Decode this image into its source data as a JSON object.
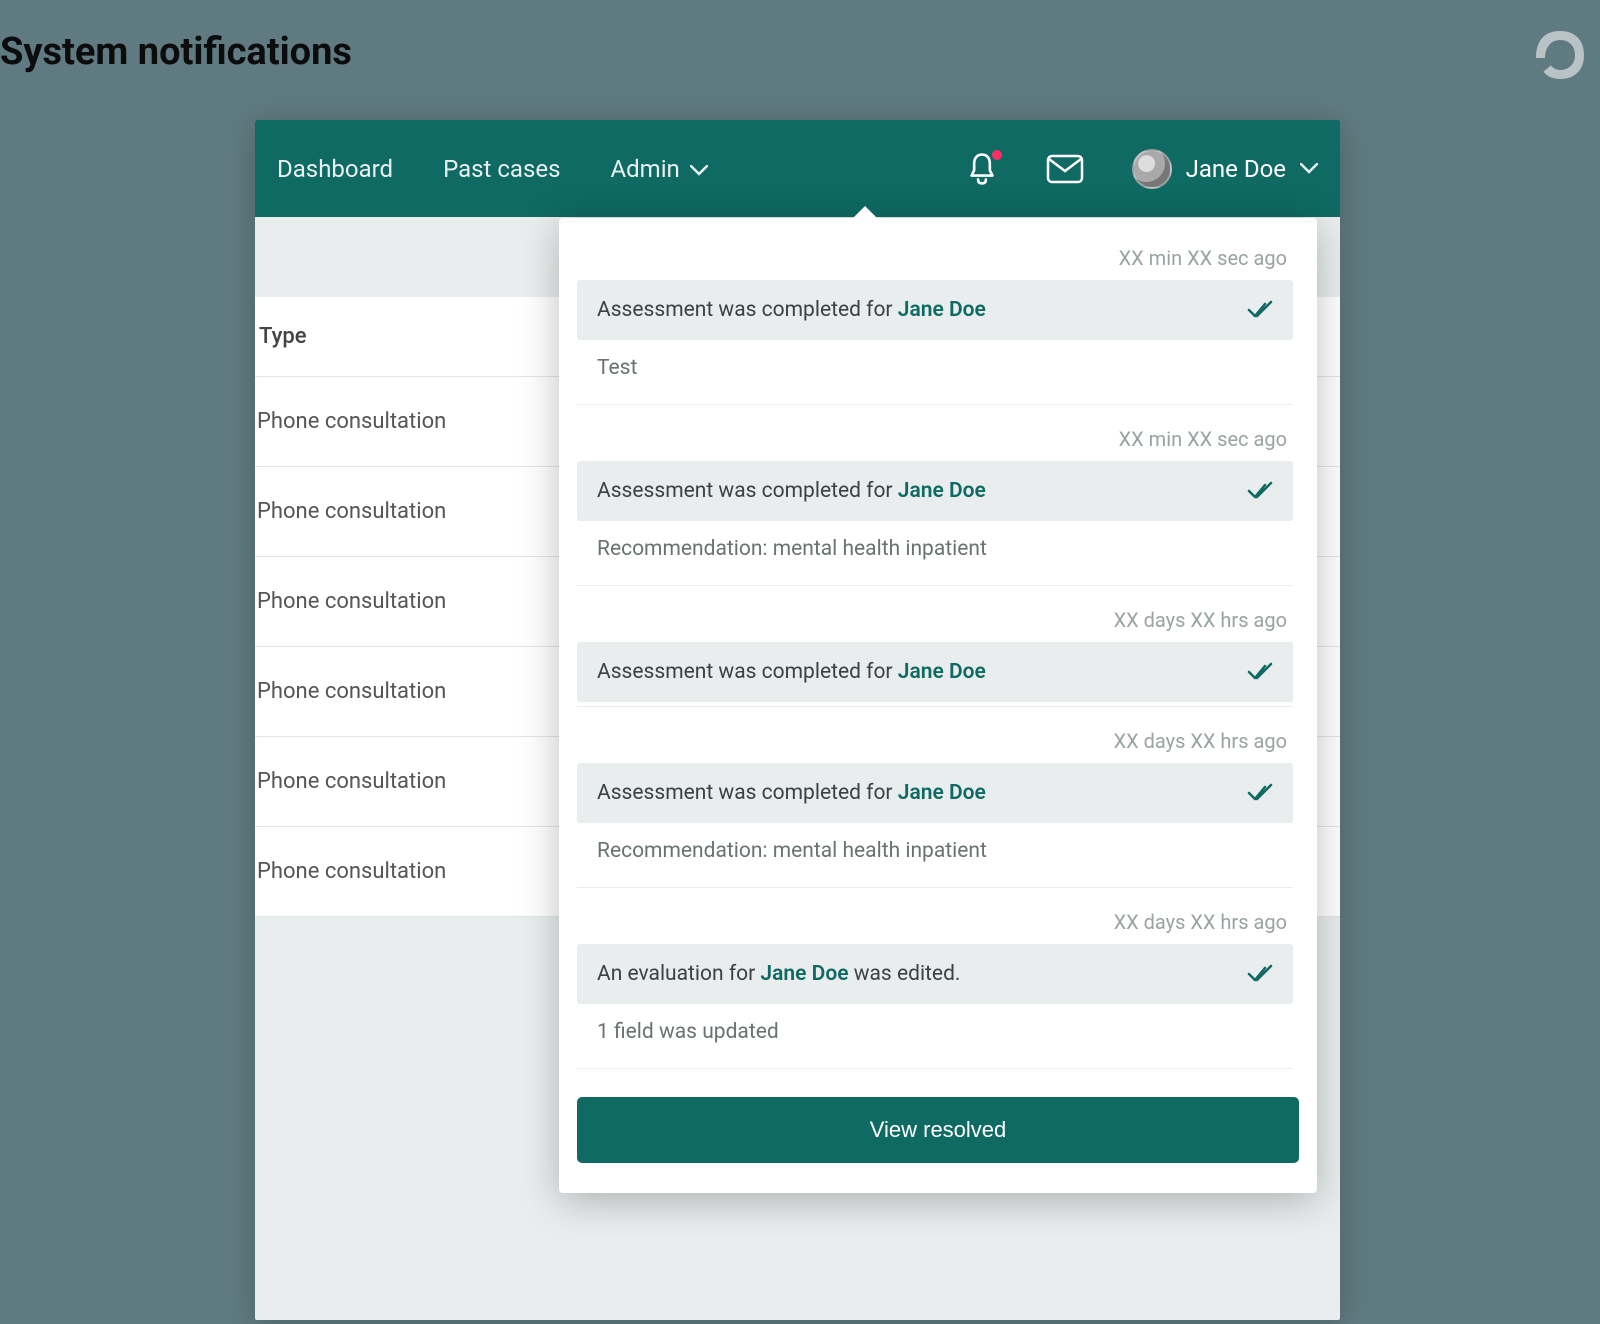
{
  "page": {
    "title": "System notifications"
  },
  "topbar": {
    "nav": {
      "dashboard": "Dashboard",
      "past_cases": "Past cases",
      "admin": "Admin"
    },
    "user_name": "Jane Doe"
  },
  "table": {
    "header_type": "Type",
    "rows": [
      {
        "type": "Phone consultation"
      },
      {
        "type": "Phone consultation"
      },
      {
        "type": "Phone consultation"
      },
      {
        "type": "Phone consultation"
      },
      {
        "type": "Phone consultation"
      },
      {
        "type": "Phone consultation"
      }
    ]
  },
  "notifications": {
    "items": [
      {
        "time": "XX min XX sec ago",
        "prefix": "Assessment was completed for ",
        "subject": "Jane Doe",
        "suffix": "",
        "body": "Test"
      },
      {
        "time": "XX min XX sec ago",
        "prefix": "Assessment was completed for ",
        "subject": "Jane Doe",
        "suffix": "",
        "body": "Recommendation: mental health inpatient"
      },
      {
        "time": "XX days XX hrs ago",
        "prefix": "Assessment was completed for ",
        "subject": "Jane Doe",
        "suffix": "",
        "body": ""
      },
      {
        "time": "XX days XX hrs ago",
        "prefix": "Assessment was completed for ",
        "subject": "Jane Doe",
        "suffix": "",
        "body": "Recommendation: mental health inpatient"
      },
      {
        "time": "XX days XX hrs ago",
        "prefix": "An evaluation for ",
        "subject": "Jane Doe",
        "suffix": " was edited.",
        "body": "1 field was updated"
      }
    ],
    "view_resolved": "View resolved"
  }
}
